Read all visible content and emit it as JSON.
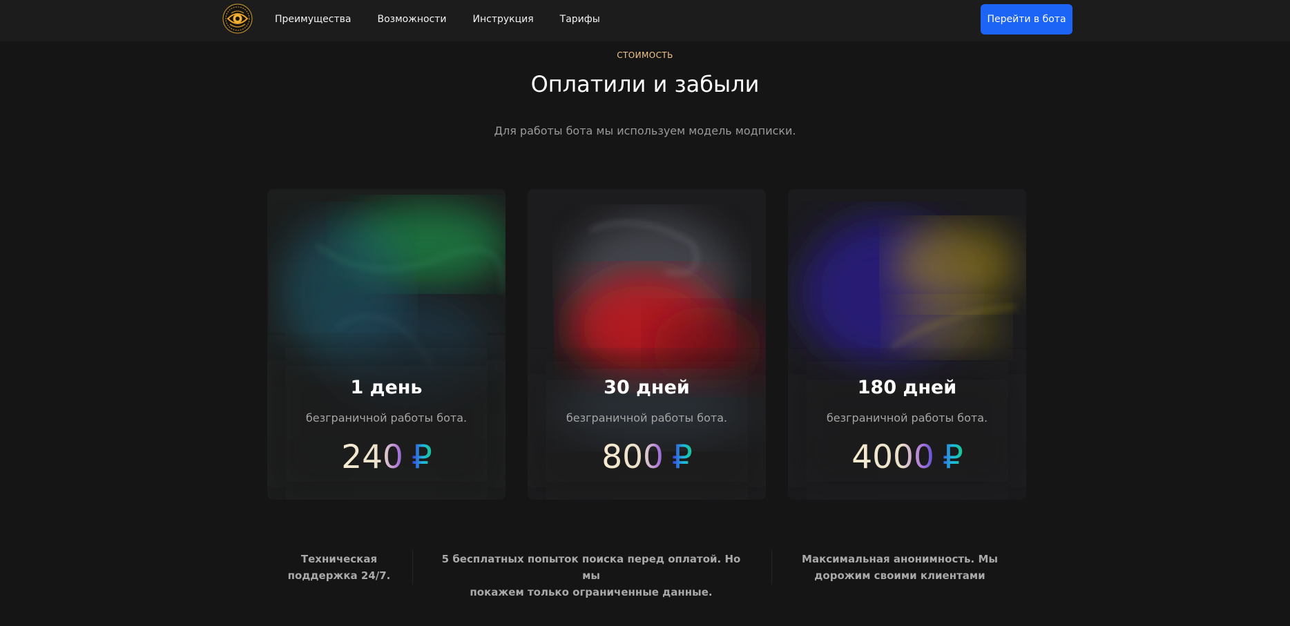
{
  "header": {
    "nav": [
      {
        "label": "Преимущества"
      },
      {
        "label": "Возможности"
      },
      {
        "label": "Инструкция"
      },
      {
        "label": "Тарифы"
      }
    ],
    "cta_label": "Перейти в бота"
  },
  "pricing": {
    "eyebrow": "СТОИМОСТЬ",
    "title": "Оплатили и забыли",
    "subtitle": "Для работы бота мы используем модель модписки.",
    "plans": [
      {
        "title": "1 день",
        "description": "безграничной работы бота.",
        "price": "240",
        "currency": "₽",
        "accent": "#2ea86a"
      },
      {
        "title": "30 дней",
        "description": "безграничной работы бота.",
        "price": "800",
        "currency": "₽",
        "accent": "#c8202a"
      },
      {
        "title": "180 дней",
        "description": "безграничной работы бота.",
        "price": "4000",
        "currency": "₽",
        "accent": "#3a2aa0"
      }
    ]
  },
  "features": [
    {
      "lines": [
        "Техническая",
        "поддержка 24/7."
      ]
    },
    {
      "lines": [
        "5 бесплатных попыток поиска перед оплатой. Но мы",
        "покажем только ограниченные данные."
      ]
    },
    {
      "lines": [
        "Максимальная анонимность. Мы",
        "дорожим своими клиентами"
      ]
    }
  ],
  "colors": {
    "background": "#151515",
    "header": "#1c1c1c",
    "cta": "#1c64f5",
    "eyebrow": "#f2c58a",
    "price_gradient": [
      "#f7ecd2",
      "#b07ad8",
      "#3b3fd6",
      "#1fb8e0",
      "#15c98c"
    ]
  },
  "icons": {
    "logo": "eye-logo-icon",
    "currency": "ruble-icon"
  }
}
